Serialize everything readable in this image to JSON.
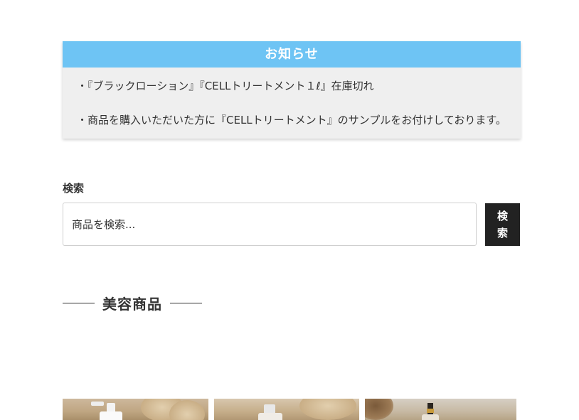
{
  "notice": {
    "title": "お知らせ",
    "line1": "・『ブラックローション』『CELLトリートメント１ℓ』在庫切れ",
    "line2": "・商品を購入いただいた方に『CELLトリートメント』のサンプルをお付けしております。"
  },
  "search": {
    "title": "検索",
    "placeholder": "商品を検索...",
    "button_char1": "検",
    "button_char2": "索"
  },
  "section": {
    "heading": "美容商品"
  },
  "colors": {
    "notice_header_bg": "#6ec4f4",
    "notice_body_bg": "#efefef",
    "search_button_bg": "#222222"
  }
}
